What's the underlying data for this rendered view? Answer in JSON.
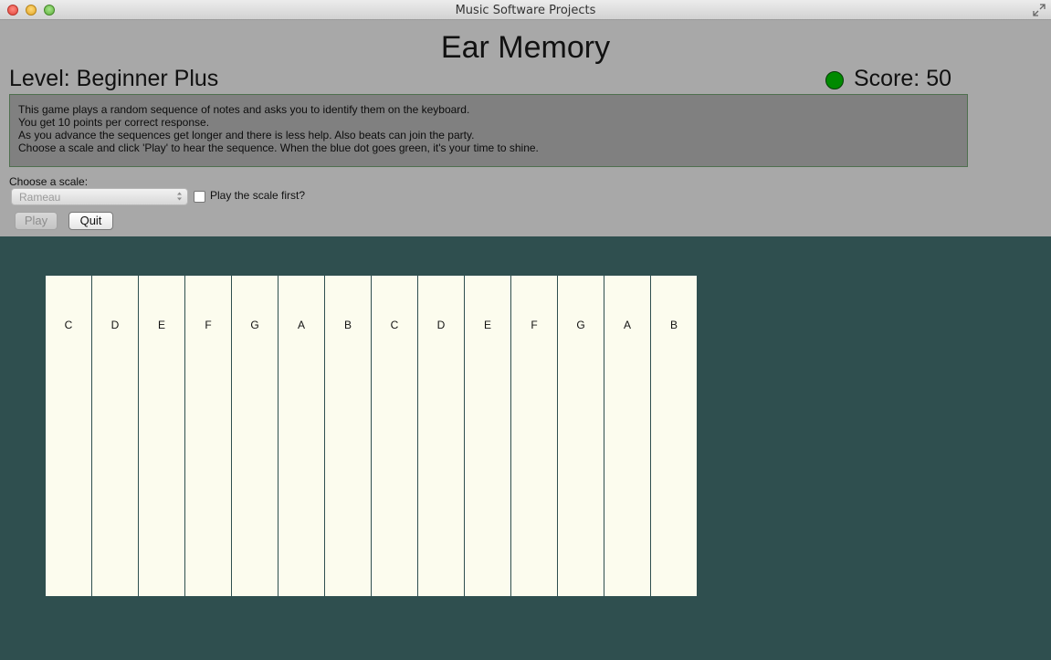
{
  "window": {
    "title": "Music Software Projects"
  },
  "header": {
    "game_title": "Ear Memory",
    "level": "Level: Beginner Plus",
    "score": "Score: 50",
    "status_color": "#008a00"
  },
  "instructions": [
    "This game plays a random sequence of notes and asks you to identify them on the keyboard.",
    "You get 10 points per correct response.",
    "As you advance the sequences get longer and there is less help. Also beats can join the party.",
    "Choose a scale and click 'Play' to hear the sequence. When the blue dot goes green, it's your time to shine."
  ],
  "controls": {
    "scale_label": "Choose a scale:",
    "scale_selected": "Rameau",
    "checkbox_label": "Play the scale first?",
    "checkbox_checked": false,
    "play_label": "Play",
    "play_enabled": false,
    "quit_label": "Quit"
  },
  "keyboard": {
    "keys": [
      "C",
      "D",
      "E",
      "F",
      "G",
      "A",
      "B",
      "C",
      "D",
      "E",
      "F",
      "G",
      "A",
      "B"
    ]
  },
  "colors": {
    "background": "#2f4f4f",
    "panel": "#a8a8a8",
    "key_fill": "#fcfcee"
  }
}
